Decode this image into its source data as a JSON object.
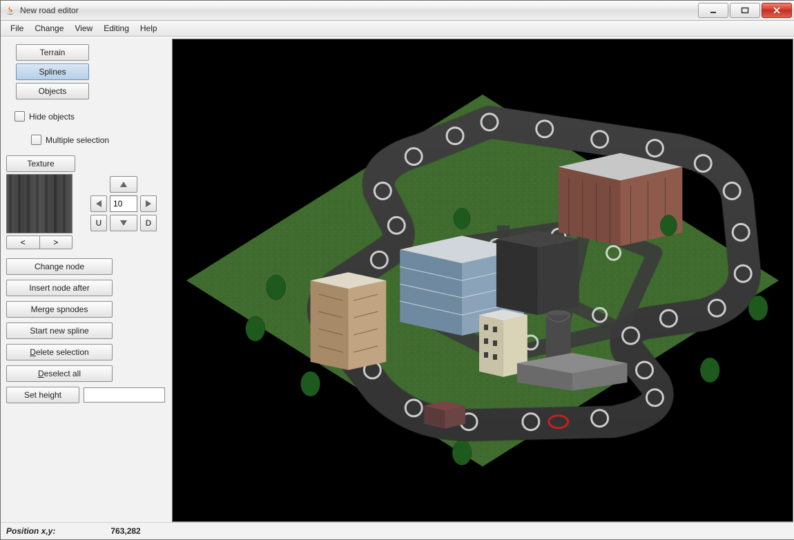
{
  "window": {
    "title": "New road editor"
  },
  "menu": {
    "file": "File",
    "change": "Change",
    "view": "View",
    "editing": "Editing",
    "help": "Help"
  },
  "modes": {
    "terrain": "Terrain",
    "splines": "Splines",
    "objects": "Objects"
  },
  "checks": {
    "hide_objects": "Hide objects",
    "multiple_selection": "Multiple selection"
  },
  "texture": {
    "button": "Texture",
    "prev": "<",
    "next": ">"
  },
  "dpad": {
    "value": "10",
    "u_label": "U",
    "d_label": "D"
  },
  "actions": {
    "change_node": "Change node",
    "insert_node_after": "Insert node after",
    "merge_spnodes": "Merge spnodes",
    "start_new_spline": "Start new spline",
    "delete_selection_pre": "D",
    "delete_selection_post": "elete selection",
    "deselect_all_pre": "D",
    "deselect_all_post": "eselect all",
    "set_height": "Set height"
  },
  "status": {
    "label": "Position x,y:",
    "value": "763,282"
  }
}
